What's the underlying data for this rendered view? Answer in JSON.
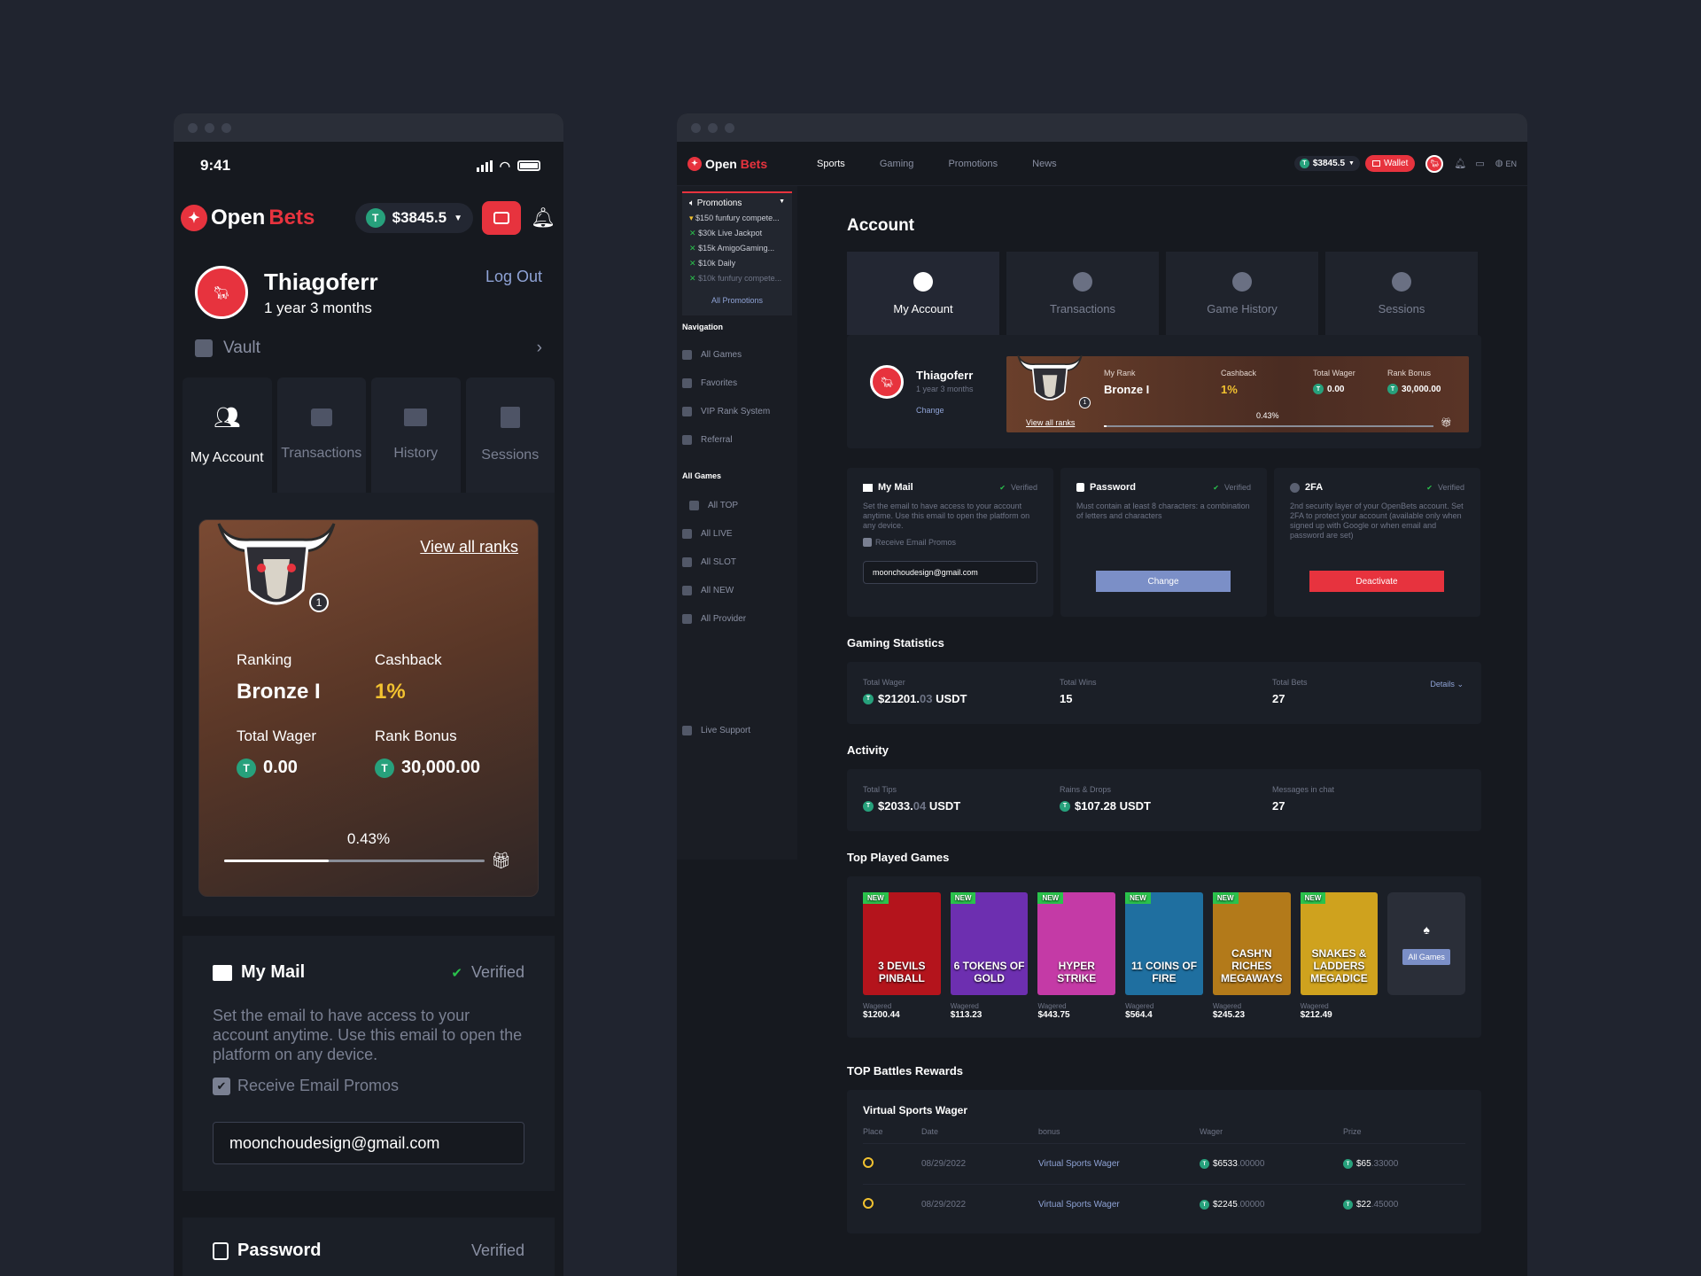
{
  "mobile": {
    "status_time": "9:41",
    "logo": {
      "open": "Open",
      "bets": "Bets"
    },
    "balance": "$3845.5",
    "user": {
      "name": "Thiagoferr",
      "age": "1 year 3 months",
      "logout": "Log Out"
    },
    "vault": "Vault",
    "tabs": [
      {
        "label": "My Account",
        "icon": "user-group-icon"
      },
      {
        "label": "Transactions",
        "icon": "wallet-icon"
      },
      {
        "label": "History",
        "icon": "laptop-icon"
      },
      {
        "label": "Sessions",
        "icon": "id-card-icon"
      }
    ],
    "rank": {
      "view_all": "View all ranks",
      "badge": "1",
      "ranking_label": "Ranking",
      "ranking": "Bronze I",
      "cashback_label": "Cashback",
      "cashback": "1%",
      "wager_label": "Total Wager",
      "wager": "0.00",
      "bonus_label": "Rank Bonus",
      "bonus": "30,000.00",
      "progress_text": "0.43%",
      "progress": 0.0043
    },
    "mail": {
      "title": "My Mail",
      "verified": "Verified",
      "desc": "Set the email to have access to your account anytime. Use this email to open the platform on any device.",
      "promos": "Receive Email Promos",
      "email": "moonchoudesign@gmail.com"
    },
    "next_section": {
      "title": "Password",
      "verified": "Verified"
    }
  },
  "desktop": {
    "logo": {
      "open": "Open",
      "bets": "Bets"
    },
    "nav": [
      "Sports",
      "Gaming",
      "Promotions",
      "News"
    ],
    "balance": "$3845.5",
    "wallet": "Wallet",
    "lang": "EN",
    "sidebar": {
      "promotions": "Promotions",
      "promo_items": [
        "$150 funfury compete...",
        "$30k Live Jackpot",
        "$15k AmigoGaming...",
        "$10k Daily",
        "$10k funfury compete..."
      ],
      "all_promotions": "All Promotions",
      "navigation": "Navigation",
      "nav_items": [
        "All Games",
        "Favorites",
        "VIP Rank System",
        "Referral"
      ],
      "all_games": "All Games",
      "game_items": [
        "All TOP",
        "All LIVE",
        "All SLOT",
        "All NEW",
        "All Provider"
      ],
      "support": "Live Support"
    },
    "page_title": "Account",
    "tabs": [
      "My Account",
      "Transactions",
      "Game History",
      "Sessions"
    ],
    "profile": {
      "name": "Thiagoferr",
      "age": "1 year 3 months",
      "change": "Change"
    },
    "rank": {
      "my_rank_label": "My Rank",
      "my_rank": "Bronze I",
      "cashback_label": "Cashback",
      "cashback": "1%",
      "wager_label": "Total Wager",
      "wager": "0.00",
      "bonus_label": "Rank Bonus",
      "bonus": "30,000.00",
      "view_all": "View all ranks",
      "badge": "1",
      "progress_text": "0.43%",
      "progress": 0.0043
    },
    "security": [
      {
        "title": "My Mail",
        "verified": "Verified",
        "desc": "Set the email to have access to your account anytime. Use this email to open the platform on any device.",
        "check": "Receive Email Promos",
        "email": "moonchoudesign@gmail.com"
      },
      {
        "title": "Password",
        "verified": "Verified",
        "desc": "Must contain at least 8 characters: a combination of letters and characters",
        "button": "Change"
      },
      {
        "title": "2FA",
        "verified": "Verified",
        "desc": "2nd security layer of your OpenBets account. Set 2FA to protect your account (available only when signed up with Google or when email and password are set)",
        "button": "Deactivate"
      }
    ],
    "gaming_stats": {
      "title": "Gaming Statistics",
      "wager_label": "Total Wager",
      "wager_main": "$21201.",
      "wager_dec": "03",
      "wager_unit": "USDT",
      "wins_label": "Total Wins",
      "wins": "15",
      "bets_label": "Total Bets",
      "bets": "27",
      "details": "Details"
    },
    "activity": {
      "title": "Activity",
      "tips_label": "Total Tips",
      "tips_main": "$2033.",
      "tips_dec": "04",
      "tips_unit": "USDT",
      "rains_label": "Rains & Drops",
      "rains": "$107.28 USDT",
      "msgs_label": "Messages in chat",
      "msgs": "27"
    },
    "top_games": {
      "title": "Top Played Games",
      "new": "NEW",
      "wagered_label": "Wagered",
      "all_games": "All Games",
      "games": [
        {
          "name": "3 DEVILS PINBALL",
          "wagered": "$1200.44",
          "color": "#b4141c"
        },
        {
          "name": "6 TOKENS OF GOLD",
          "wagered": "$113.23",
          "color": "#6d2fb0"
        },
        {
          "name": "HYPER STRIKE",
          "wagered": "$443.75",
          "color": "#c43aa6"
        },
        {
          "name": "11 COINS OF FIRE",
          "wagered": "$564.4",
          "color": "#1f6fa0"
        },
        {
          "name": "CASH'N RICHES MEGAWAYS",
          "wagered": "$245.23",
          "color": "#b37a1a"
        },
        {
          "name": "SNAKES & LADDERS MEGADICE",
          "wagered": "$212.49",
          "color": "#cfa21e"
        }
      ]
    },
    "battles": {
      "title": "TOP Battles Rewards",
      "subtitle": "Virtual Sports Wager",
      "headers": [
        "Place",
        "Date",
        "bonus",
        "Wager",
        "Prize"
      ],
      "rows": [
        {
          "date": "08/29/2022",
          "bonus": "Virtual Sports Wager",
          "wager_main": "$6533",
          "wager_dec": ".00000",
          "prize_main": "$65",
          "prize_dec": ".33000"
        },
        {
          "date": "08/29/2022",
          "bonus": "Virtual Sports Wager",
          "wager_main": "$2245",
          "wager_dec": ".00000",
          "prize_main": "$22",
          "prize_dec": ".45000"
        }
      ]
    }
  },
  "colors": {
    "bg": "#20242f",
    "panel": "#1b1f27",
    "accent_red": "#e7333e",
    "usdt_green": "#27a17c",
    "verified_green": "#2ac24c",
    "gold": "#f2c230",
    "change_btn": "#7b8fc7"
  }
}
